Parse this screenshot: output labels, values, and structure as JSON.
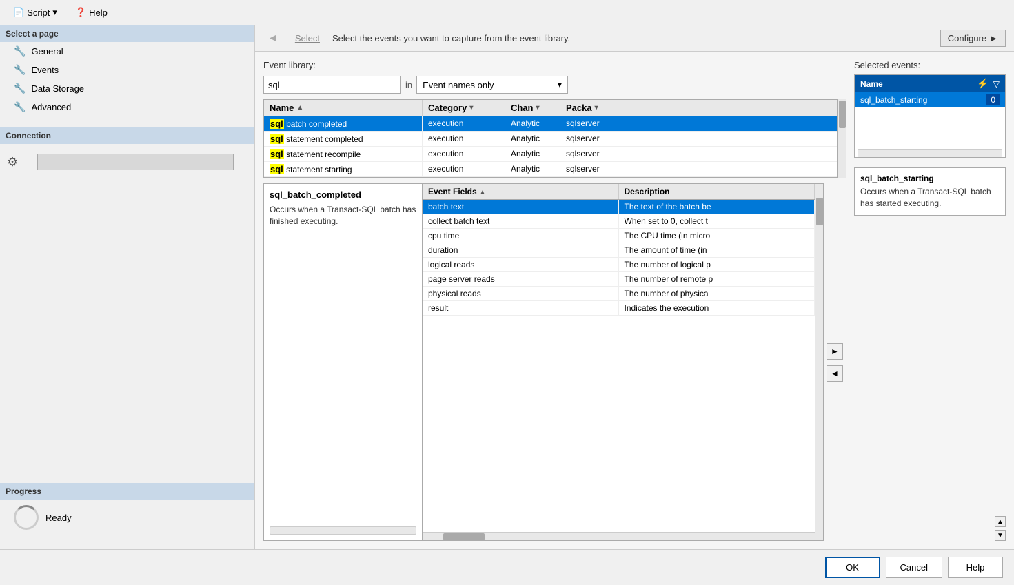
{
  "toolbar": {
    "script_label": "Script",
    "help_label": "Help"
  },
  "left_panel": {
    "select_page_label": "Select a page",
    "nav_items": [
      {
        "id": "general",
        "label": "General"
      },
      {
        "id": "events",
        "label": "Events"
      },
      {
        "id": "data_storage",
        "label": "Data Storage"
      },
      {
        "id": "advanced",
        "label": "Advanced"
      }
    ],
    "connection_label": "Connection",
    "progress_label": "Progress",
    "ready_label": "Ready"
  },
  "nav_bar": {
    "back_arrow": "◄",
    "select_label": "Select",
    "description": "Select the events you want to capture from the event library.",
    "configure_label": "Configure",
    "forward_arrow": "►"
  },
  "event_library": {
    "label": "Event library:",
    "search_value": "sql",
    "in_label": "in",
    "dropdown_label": "Event names only",
    "table": {
      "columns": [
        {
          "id": "name",
          "label": "Name",
          "sort": "▲"
        },
        {
          "id": "category",
          "label": "Category"
        },
        {
          "id": "channel",
          "label": "Chan"
        },
        {
          "id": "package",
          "label": "Packa"
        }
      ],
      "rows": [
        {
          "name_prefix": "sql",
          "name_rest": " batch  completed",
          "category": "execution",
          "channel": "Analytic",
          "package": "sqlserver",
          "selected": true
        },
        {
          "name_prefix": "sql",
          "name_rest": " statement  completed",
          "category": "execution",
          "channel": "Analytic",
          "package": "sqlserver",
          "selected": false
        },
        {
          "name_prefix": "sql",
          "name_rest": " statement  recompile",
          "category": "execution",
          "channel": "Analytic",
          "package": "sqlserver",
          "selected": false
        },
        {
          "name_prefix": "sql",
          "name_rest": " statement  starting",
          "category": "execution",
          "channel": "Analytic",
          "package": "sqlserver",
          "selected": false
        }
      ]
    }
  },
  "event_detail": {
    "name": "sql_batch_completed",
    "description": "Occurs when a Transact-SQL batch has finished executing."
  },
  "fields_panel": {
    "columns": [
      {
        "label": "Event Fields",
        "sort": "▲"
      },
      {
        "label": "Description"
      }
    ],
    "rows": [
      {
        "field": "batch  text",
        "description": "The text of the batch be",
        "selected": true
      },
      {
        "field": "collect  batch  text",
        "description": "When set to 0, collect t",
        "selected": false
      },
      {
        "field": "cpu  time",
        "description": "The CPU time (in micro",
        "selected": false
      },
      {
        "field": "duration",
        "description": "The amount of time (in",
        "selected": false
      },
      {
        "field": "logical  reads",
        "description": "The number of logical p",
        "selected": false
      },
      {
        "field": "page  server  reads",
        "description": "The number of remote p",
        "selected": false
      },
      {
        "field": "physical  reads",
        "description": "The number of physica",
        "selected": false
      },
      {
        "field": "result",
        "description": "Indicates the execution",
        "selected": false
      }
    ]
  },
  "middle_arrows": {
    "right": "►",
    "left": "◄"
  },
  "selected_events": {
    "label": "Selected events:",
    "table_header": "Name",
    "filter_icon": "⚡",
    "funnel_icon": "▽",
    "rows": [
      {
        "name": "sql_batch_starting",
        "count": "0"
      }
    ],
    "detail": {
      "name": "sql_batch_starting",
      "description": "Occurs when a Transact-SQL batch has started executing."
    }
  },
  "bottom_bar": {
    "ok_label": "OK",
    "cancel_label": "Cancel",
    "help_label": "Help"
  }
}
